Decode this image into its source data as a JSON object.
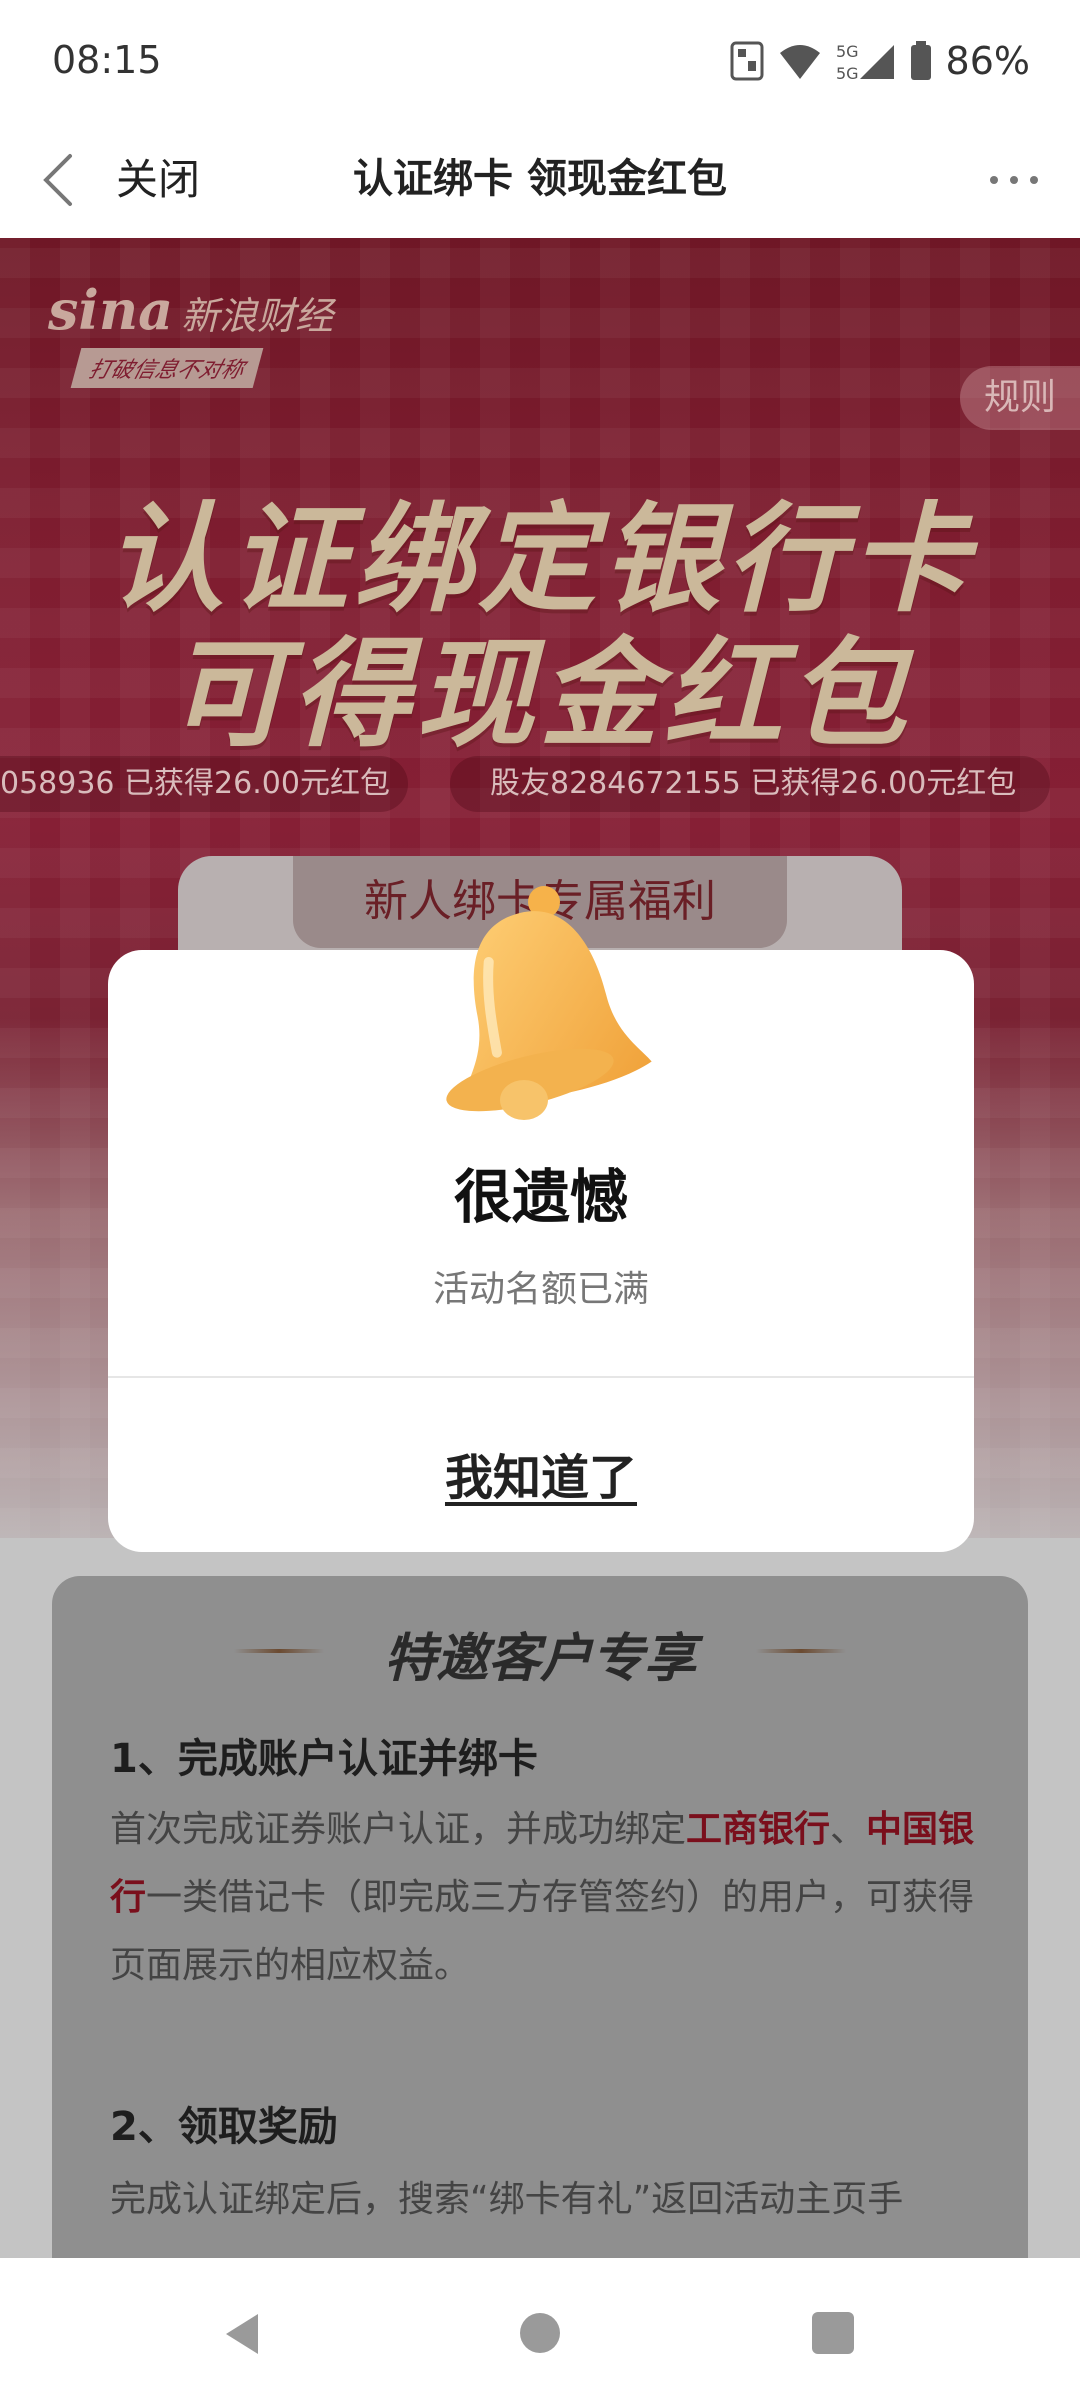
{
  "status_bar": {
    "time": "08:15",
    "network": "5G",
    "battery": "86%"
  },
  "nav": {
    "close_label": "关闭",
    "title": "认证绑卡 领现金红包"
  },
  "banner": {
    "logo_text": "sina",
    "logo_cn": "新浪财经",
    "logo_slogan": "打破信息不对称",
    "rules_label": "规则",
    "headline_line1": "认证绑定银行卡",
    "headline_line2": "可得现金红包",
    "tickers": [
      "058936 已获得26.00元红包",
      "股友8284672155 已获得26.00元红包"
    ]
  },
  "newbie_card": {
    "tab_label": "新人绑卡专属福利"
  },
  "benefits": {
    "title": "特邀客户专享",
    "step1_title": "1、完成账户认证并绑卡",
    "step1_text_a": "首次完成证券账户认证，并成功绑定",
    "step1_bank1": "工商银行",
    "step1_sep": "、",
    "step1_bank2": "中国银行",
    "step1_text_b": "一类借记卡（即完成三方存管签约）的用户，可获得页面展示的相应权益。",
    "step2_title": "2、领取奖励",
    "step2_text": "完成认证绑定后，搜索“绑卡有礼”返回活动主页手"
  },
  "modal": {
    "title": "很遗憾",
    "message": "活动名额已满",
    "button_label": "我知道了",
    "icon": "bell-icon"
  },
  "colors": {
    "accent_red": "#861f35",
    "highlight": "#7a0f1c"
  }
}
